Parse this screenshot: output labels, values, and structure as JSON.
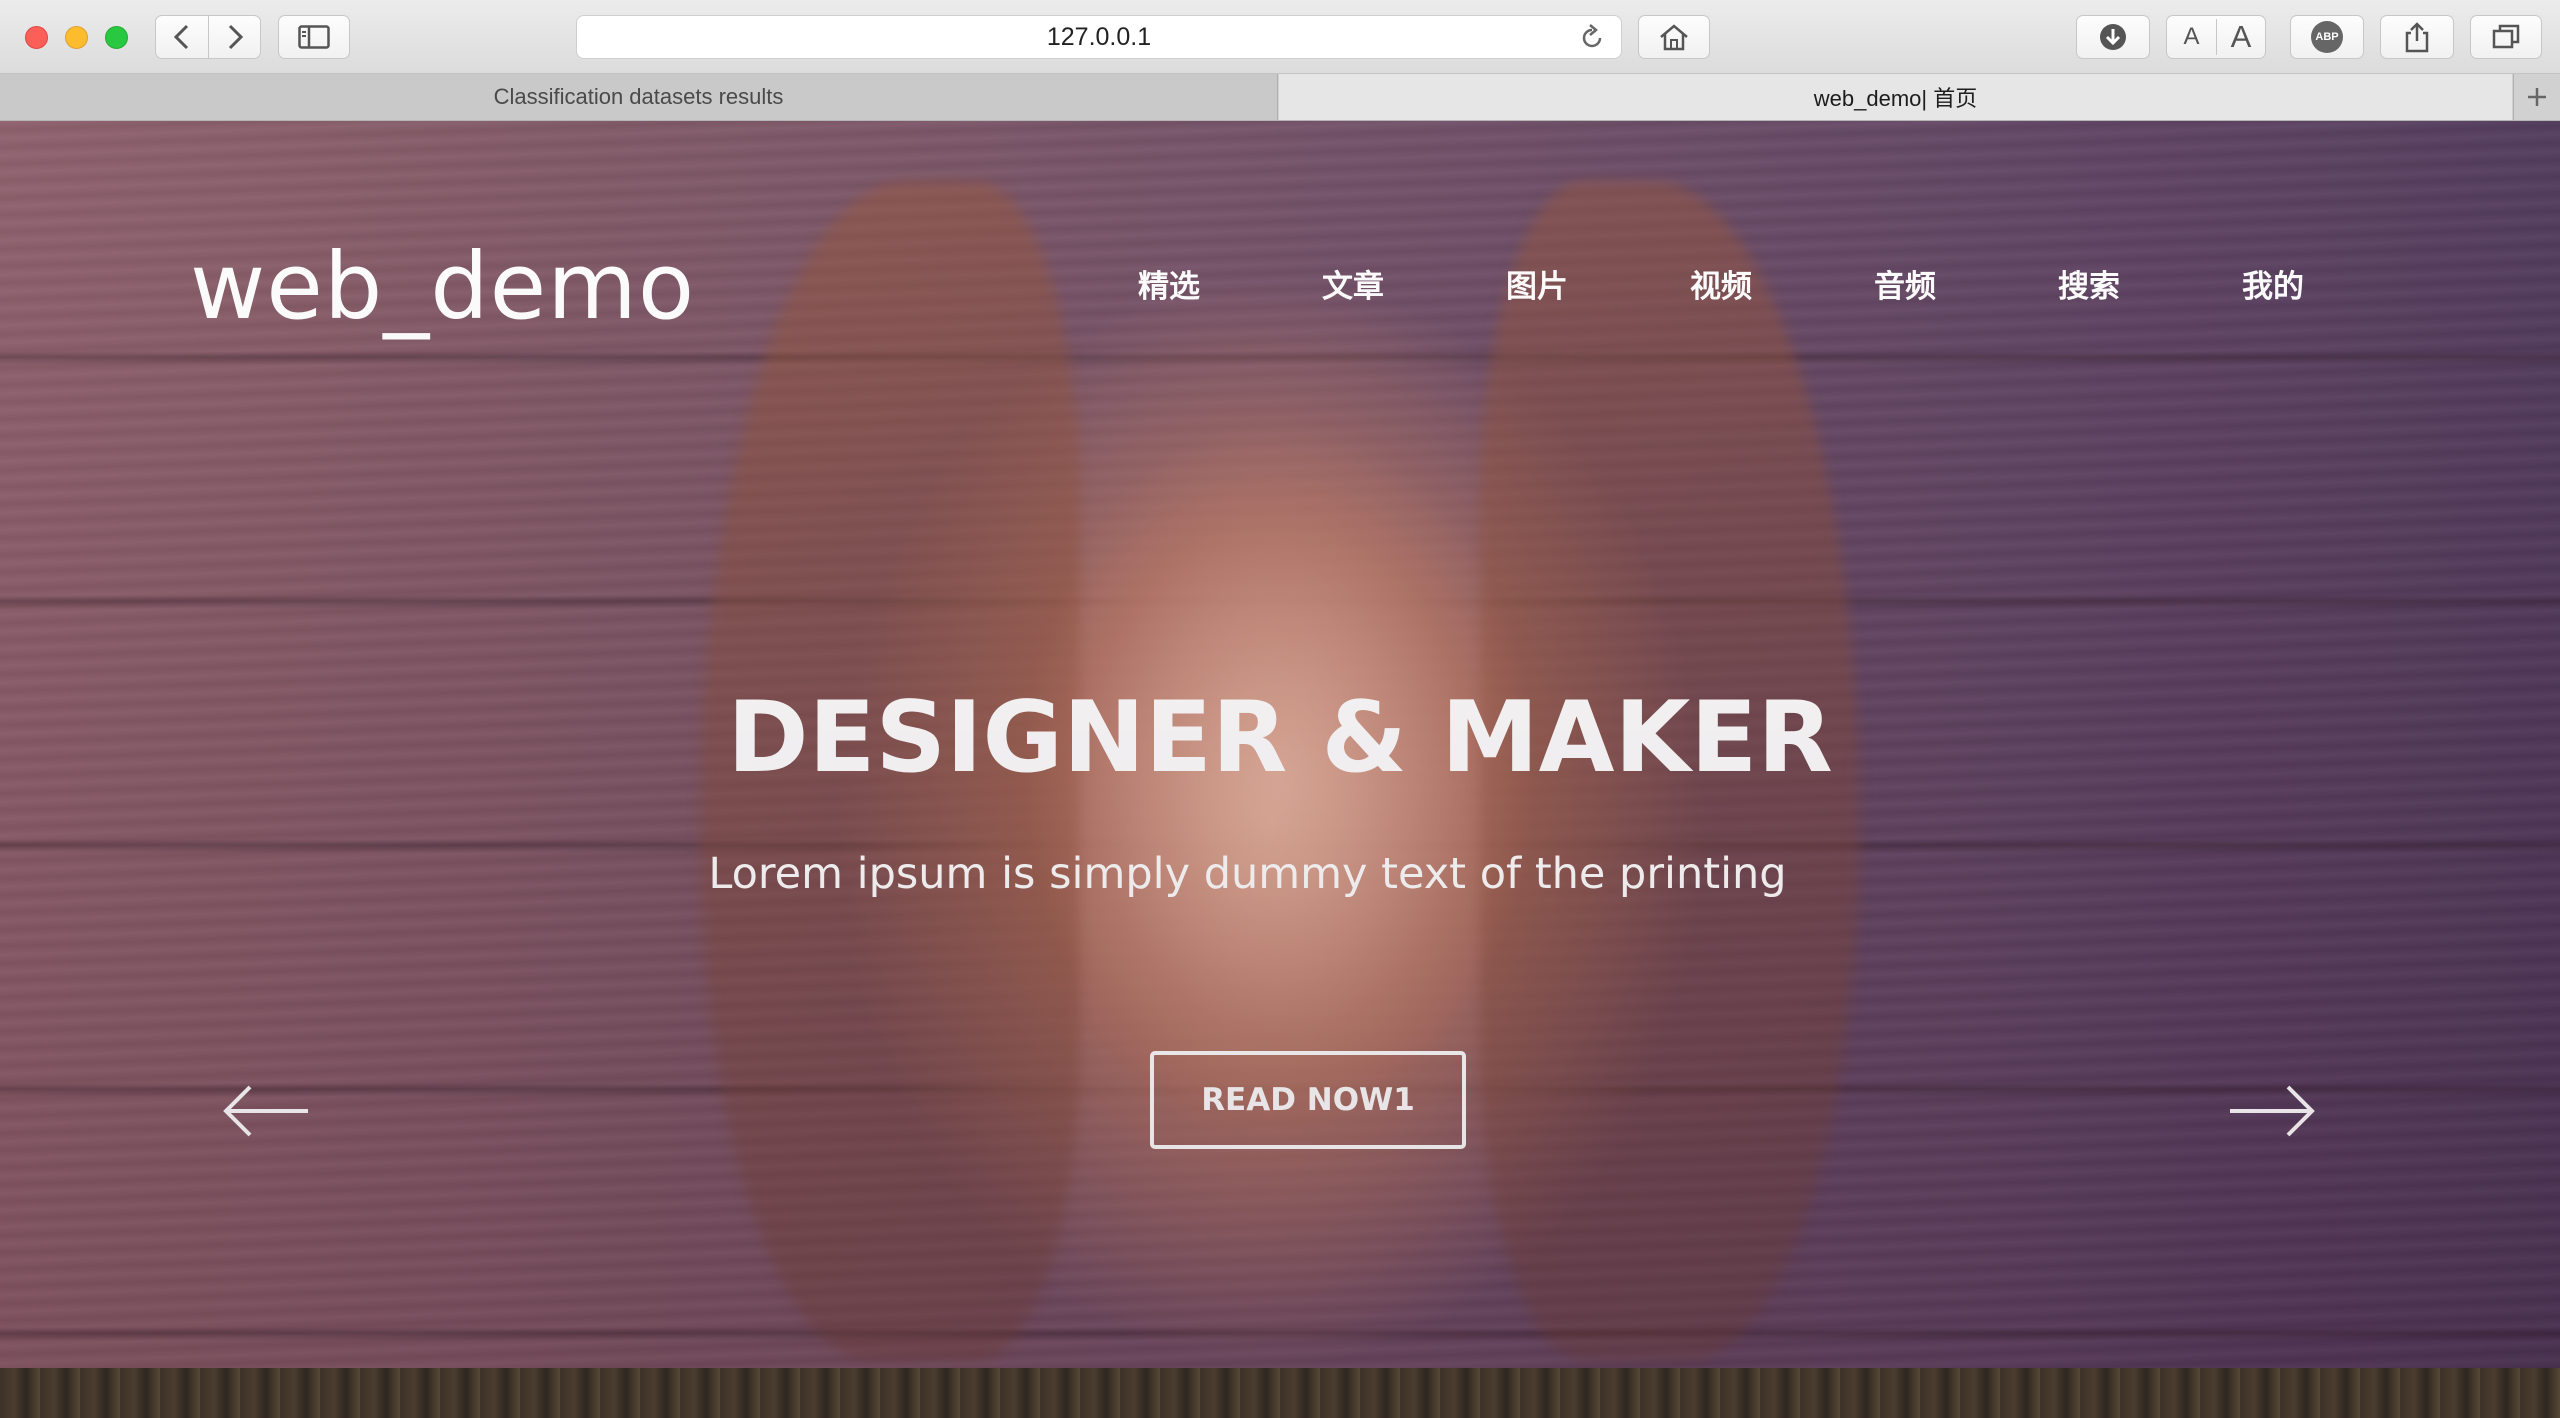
{
  "browser": {
    "url": "127.0.0.1",
    "tabs": [
      {
        "label": "Classification datasets results",
        "active": false
      },
      {
        "label": "web_demo| 首页",
        "active": true
      }
    ],
    "font_small_label": "A",
    "font_large_label": "A",
    "adblock_label": "ABP"
  },
  "site": {
    "logo": "web_demo",
    "nav": [
      "精选",
      "文章",
      "图片",
      "视频",
      "音频",
      "搜索",
      "我的"
    ],
    "hero": {
      "headline": "DESIGNER & MAKER",
      "subline": "Lorem ipsum is simply dummy text of the printing",
      "cta": "READ NOW1"
    }
  }
}
